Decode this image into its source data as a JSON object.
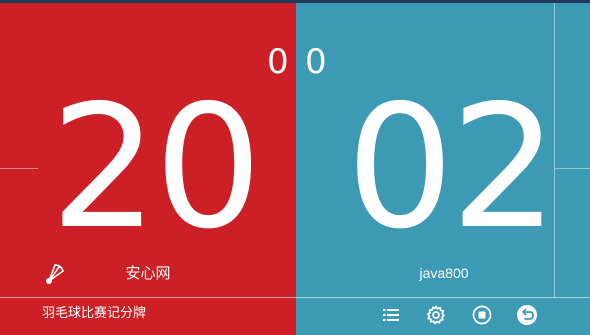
{
  "scoreboard": {
    "left": {
      "games": "0",
      "points": "20",
      "player": "安心网",
      "color": "#cc2026"
    },
    "right": {
      "games": "0",
      "points": "02",
      "player": "java800",
      "color": "#3c9ab4"
    }
  },
  "footer": {
    "app_title": "羽毛球比赛记分牌",
    "icons": [
      "list-icon",
      "settings-icon",
      "stop-icon",
      "back-icon"
    ]
  },
  "server_indicator": {
    "icon": "shuttlecock-icon",
    "side": "left"
  }
}
